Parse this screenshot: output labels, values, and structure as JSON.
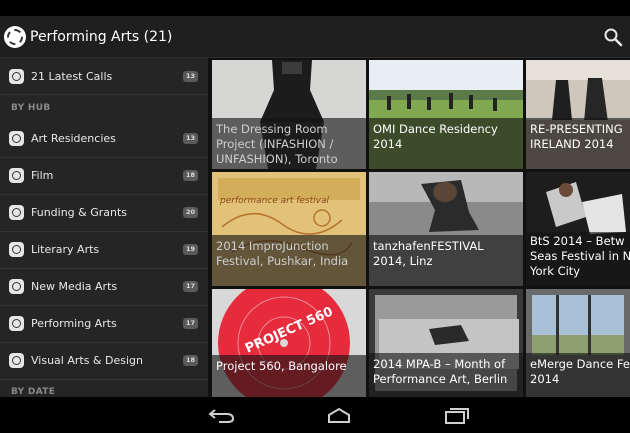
{
  "action_bar": {
    "title": "Performing Arts (21)",
    "search_icon": "search-icon",
    "app_icon": "app-logo-icon"
  },
  "sidebar": {
    "latest": {
      "label": "21 Latest Calls",
      "count": "13"
    },
    "hub_header": "BY HUB",
    "items": [
      {
        "label": "Art Residencies",
        "count": "13"
      },
      {
        "label": "Film",
        "count": "18"
      },
      {
        "label": "Funding & Grants",
        "count": "20"
      },
      {
        "label": "Literary Arts",
        "count": "19"
      },
      {
        "label": "New Media Arts",
        "count": "17"
      },
      {
        "label": "Performing Arts",
        "count": "17"
      },
      {
        "label": "Visual Arts & Design",
        "count": "18"
      }
    ],
    "date_header": "BY DATE"
  },
  "grid": {
    "tiles": [
      {
        "lines": [
          "The Dressing Room",
          "Project (INFASHION /",
          "UNFASHION), Toronto"
        ],
        "faded": true
      },
      {
        "lines": [
          "OMI Dance Residency",
          "2014"
        ],
        "faded": false
      },
      {
        "lines": [
          "RE-PRESENTING",
          "IRELAND 2014"
        ],
        "faded": false
      },
      {
        "lines": [
          "2014 ImproJunction",
          "Festival, Pushkar, India"
        ],
        "faded": true
      },
      {
        "lines": [
          "tanzhafenFESTIVAL",
          "2014, Linz"
        ],
        "faded": false
      },
      {
        "lines": [
          "BtS 2014 – Betw",
          "Seas Festival in Ne",
          "York City"
        ],
        "faded": false
      },
      {
        "lines": [
          "Project 560, Bangalore"
        ],
        "faded": false
      },
      {
        "lines": [
          "2014 MPA-B – Month of",
          "Performance Art, Berlin"
        ],
        "faded": false
      },
      {
        "lines": [
          "eMerge Dance Fe",
          "2014"
        ],
        "faded": false
      }
    ],
    "artwork": {
      "poster_heading": "performance art festival",
      "record_text": "PROJECT 560"
    }
  },
  "colors": {
    "background": "#000000",
    "sidebar": "#252525",
    "action_bar": "#1f1f1f",
    "caption_overlay": "rgba(20,20,20,0.62)"
  },
  "system_nav": {
    "back_icon": "back-icon",
    "home_icon": "home-icon",
    "recents_icon": "recent-apps-icon"
  }
}
